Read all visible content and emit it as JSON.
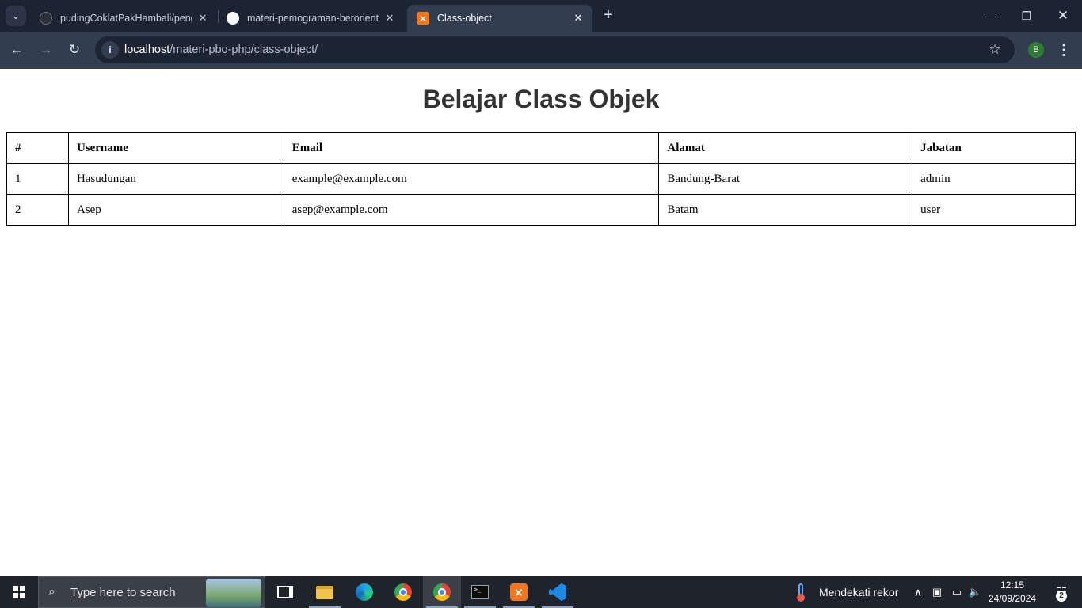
{
  "browser": {
    "tabs": [
      {
        "title": "pudingCoklatPakHambali/peng",
        "icon": "github-icon",
        "active": false
      },
      {
        "title": "materi-pemograman-berorient",
        "icon": "github-icon",
        "active": false
      },
      {
        "title": "Class-object",
        "icon": "xampp-icon",
        "active": true
      }
    ],
    "url_host": "localhost",
    "url_path": "/materi-pbo-php/class-object/",
    "profile_initial": "B"
  },
  "page": {
    "title": "Belajar Class Objek",
    "table": {
      "headers": [
        "#",
        "Username",
        "Email",
        "Alamat",
        "Jabatan"
      ],
      "rows": [
        [
          "1",
          "Hasudungan",
          "example@example.com",
          "Bandung-Barat",
          "admin"
        ],
        [
          "2",
          "Asep",
          "asep@example.com",
          "Batam",
          "user"
        ]
      ]
    }
  },
  "taskbar": {
    "search_placeholder": "Type here to search",
    "apps": [
      "task-view",
      "file-explorer",
      "edge",
      "chrome",
      "chrome-profile",
      "terminal",
      "xampp",
      "vscode"
    ],
    "weather_text": "Mendekati rekor",
    "time": "12:15",
    "date": "24/09/2024",
    "notification_count": "2"
  },
  "colors": {
    "tabbar_bg": "#1c2433",
    "toolbar_bg": "#333d50",
    "taskbar_bg": "#1f232b",
    "title_text": "#333333"
  }
}
